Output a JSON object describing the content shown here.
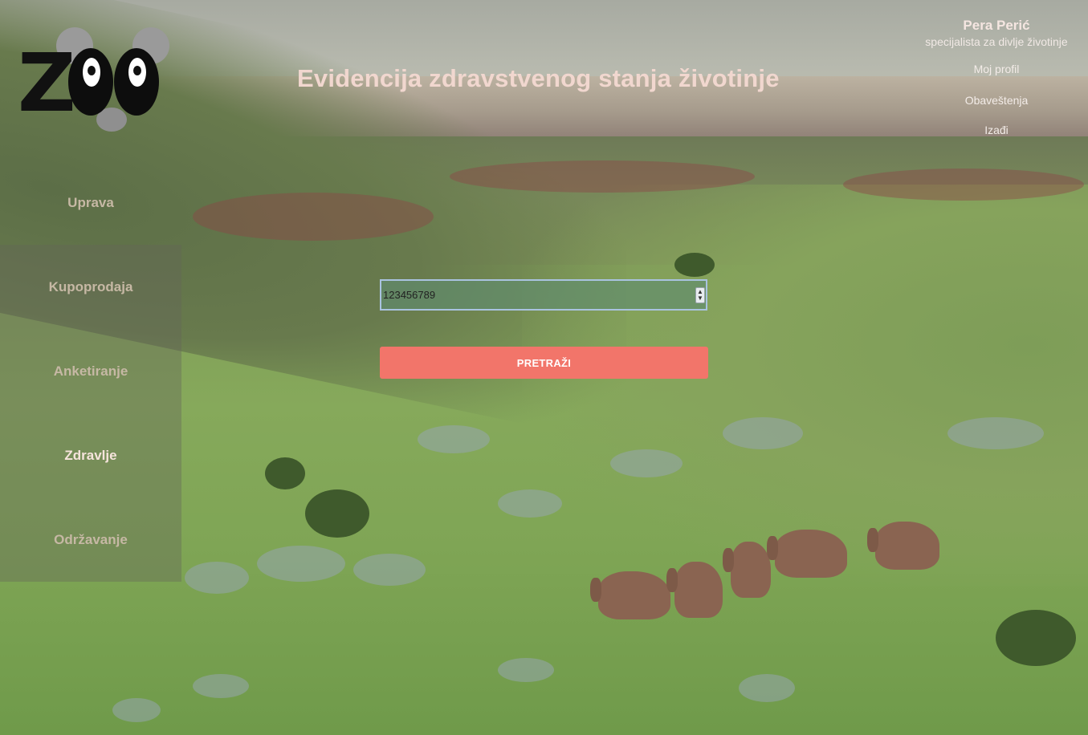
{
  "header": {
    "title": "Evidencija zdravstvenog stanja životinje"
  },
  "user": {
    "name": "Pera Perić",
    "role": "specijalista za divlje životinje",
    "links": [
      "Moj profil",
      "Obaveštenja",
      "Izađi"
    ]
  },
  "sidebar": {
    "items": [
      {
        "label": "Uprava",
        "active": false
      },
      {
        "label": "Kupoprodaja",
        "active": false
      },
      {
        "label": "Anketiranje",
        "active": false
      },
      {
        "label": "Zdravlje",
        "active": true
      },
      {
        "label": "Održavanje",
        "active": false
      }
    ]
  },
  "search": {
    "value": "123456789",
    "button_label": "PRETRAŽI"
  },
  "colors": {
    "accent": "#f2756a",
    "title": "#f1d7cf"
  },
  "icons": {
    "logo": "zoo-panda-logo",
    "spinner": "number-spinner-icon"
  }
}
